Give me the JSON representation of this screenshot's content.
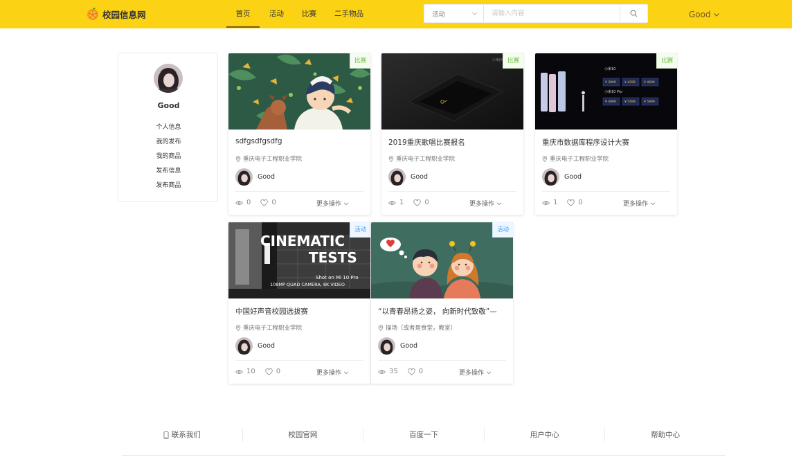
{
  "header": {
    "logo_text": "校园信息网",
    "nav": [
      {
        "label": "首页",
        "active": true
      },
      {
        "label": "活动",
        "active": false
      },
      {
        "label": "比赛",
        "active": false
      },
      {
        "label": "二手物品",
        "active": false
      }
    ],
    "search": {
      "category": "活动",
      "placeholder": "请输入内容",
      "icon": "search-icon"
    },
    "user": {
      "name": "Good",
      "icon": "chevron-down-icon"
    }
  },
  "sidebar": {
    "username": "Good",
    "menu": [
      "个人信息",
      "我的发布",
      "我的商品",
      "发布信息",
      "发布商品"
    ]
  },
  "cards": [
    {
      "tag": "比赛",
      "tag_type": "match",
      "title": "sdfgsdfgsdfg",
      "location": "重庆电子工程职业学院",
      "user": "Good",
      "views": "0",
      "likes": "0",
      "more": "更多操作"
    },
    {
      "tag": "比赛",
      "tag_type": "match",
      "title": "2019重庆歌唱比赛报名",
      "location": "重庆电子工程职业学院",
      "user": "Good",
      "views": "1",
      "likes": "0",
      "more": "更多操作"
    },
    {
      "tag": "比赛",
      "tag_type": "match",
      "title": "重庆市数据库程序设计大赛",
      "location": "重庆电子工程职业学院",
      "user": "Good",
      "views": "1",
      "likes": "0",
      "more": "更多操作"
    },
    {
      "tag": "活动",
      "tag_type": "activity",
      "title": "中国好声音校园选拔赛",
      "location": "重庆电子工程职业学院",
      "user": "Good",
      "views": "10",
      "likes": "0",
      "more": "更多操作",
      "image_text": [
        "CINEMATIC",
        "TESTS",
        "Shot on Mi 10 Pro",
        "108MP QUAD CAMERA, 8K VIDEO"
      ]
    },
    {
      "tag": "活动",
      "tag_type": "activity",
      "title": "“以青春昂扬之姿， 向新时代致敬”—",
      "location": "操场（或者是食堂，教室）",
      "user": "Good",
      "views": "35",
      "likes": "0",
      "more": "更多操作"
    }
  ],
  "footer": {
    "links": [
      {
        "label": "联系我们",
        "icon": "phone-icon"
      },
      {
        "label": "校园官网"
      },
      {
        "label": "百度一下"
      },
      {
        "label": "用户中心"
      },
      {
        "label": "帮助中心"
      }
    ]
  },
  "colors": {
    "header_bg": "#fcd215",
    "tag_match": "#67c23a",
    "tag_activity": "#409eff"
  }
}
